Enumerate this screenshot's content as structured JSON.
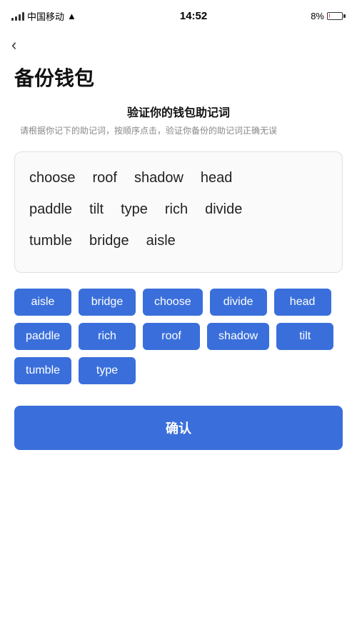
{
  "statusBar": {
    "carrier": "中国移动",
    "time": "14:52",
    "battery": "8%"
  },
  "page": {
    "backLabel": "‹",
    "title": "备份钱包",
    "subtitleMain": "验证你的钱包助记词",
    "subtitleDesc": "请根据你记下的助记词，按顺序点击，验证你备份的助记词正确无误"
  },
  "displayWords": [
    [
      "choose",
      "roof",
      "shadow",
      "head"
    ],
    [
      "paddle",
      "tilt",
      "type",
      "rich",
      "divide"
    ],
    [
      "tumble",
      "bridge",
      "aisle"
    ]
  ],
  "wordButtons": [
    "aisle",
    "bridge",
    "choose",
    "divide",
    "head",
    "paddle",
    "rich",
    "roof",
    "shadow",
    "tilt",
    "tumble",
    "type"
  ],
  "confirmButton": {
    "label": "确认"
  }
}
